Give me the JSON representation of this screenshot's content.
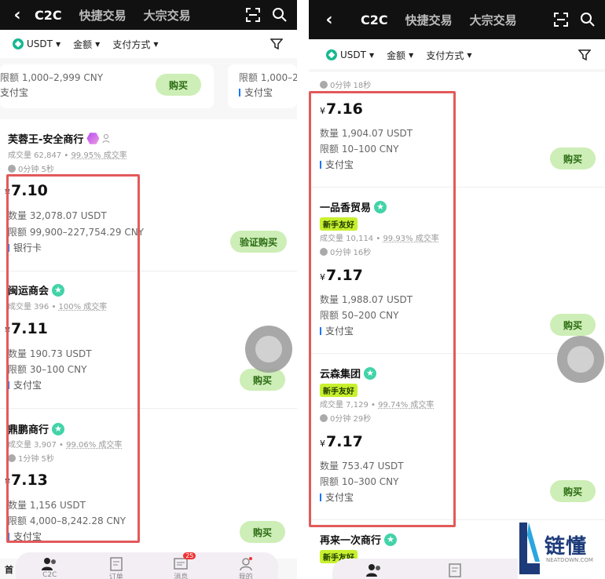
{
  "left": {
    "tabs": [
      "C2C",
      "快捷交易",
      "大宗交易"
    ],
    "filters": {
      "coin": "USDT",
      "amount": "金额",
      "payment": "支付方式"
    },
    "top_card": {
      "limit": "限额 1,000–2,999 CNY",
      "pay": "支付宝",
      "btn": "购买"
    },
    "top_card2": {
      "limit": "限额 1,000–2",
      "pay": "支付宝"
    },
    "merchants": [
      {
        "name": "芙蓉王-安全商行",
        "stat_a": "成交量 62,847",
        "stat_b": "99.95% 成交率",
        "time": "0分钟 5秒",
        "price": "7.10",
        "qty": "数量 32,078.07 USDT",
        "limit": "限额 99,900–227,754.29 CNY",
        "pay": "银行卡",
        "btn": "验证购买"
      },
      {
        "name": "闽运商会",
        "stat_a": "成交量 396",
        "stat_b": "100% 成交率",
        "time": "",
        "price": "7.11",
        "qty": "数量 190.73 USDT",
        "limit": "限额 30–100 CNY",
        "pay": "支付宝",
        "btn": "购买"
      },
      {
        "name": "鼎鹏商行",
        "stat_a": "成交量 3,907",
        "stat_b": "99.06% 成交率",
        "time": "1分钟 5秒",
        "price": "7.13",
        "qty": "数量 1,156 USDT",
        "limit": "限额 4,000–8,242.28 CNY",
        "pay": "支付宝",
        "btn": "购买"
      }
    ],
    "nav": [
      {
        "label": "C2C",
        "badge": ""
      },
      {
        "label": "订单",
        "badge": ""
      },
      {
        "label": "消息",
        "badge": "25"
      },
      {
        "label": "我的",
        "badge": ""
      }
    ],
    "nav_prefix": "首"
  },
  "right": {
    "tabs": [
      "C2C",
      "快捷交易",
      "大宗交易"
    ],
    "filters": {
      "coin": "USDT",
      "amount": "金额",
      "payment": "支付方式"
    },
    "first": {
      "time": "0分钟 18秒",
      "price": "7.16",
      "qty": "数量 1,904.07 USDT",
      "limit": "限额 10–100 CNY",
      "pay": "支付宝",
      "btn": "购买"
    },
    "merchants": [
      {
        "name": "一品香贸易",
        "badge": "新手友好",
        "stat_a": "成交量 10,114",
        "stat_b": "99.93% 成交率",
        "time": "0分钟 16秒",
        "price": "7.17",
        "qty": "数量 1,988.07 USDT",
        "limit": "限额 50–200 CNY",
        "pay": "支付宝",
        "btn": "购买"
      },
      {
        "name": "云森集团",
        "badge": "新手友好",
        "stat_a": "成交量 7,129",
        "stat_b": "99.74% 成交率",
        "time": "0分钟 29秒",
        "price": "7.17",
        "qty": "数量 753.47 USDT",
        "limit": "限额 10–300 CNY",
        "pay": "支付宝",
        "btn": "购买"
      }
    ],
    "last": {
      "name": "再来一次商行",
      "badge": "新手友好"
    },
    "nav_badge": "25"
  },
  "watermark": {
    "text": "链懂",
    "sub": "NEATDOWN.COM"
  },
  "currency_symbol": "¥"
}
